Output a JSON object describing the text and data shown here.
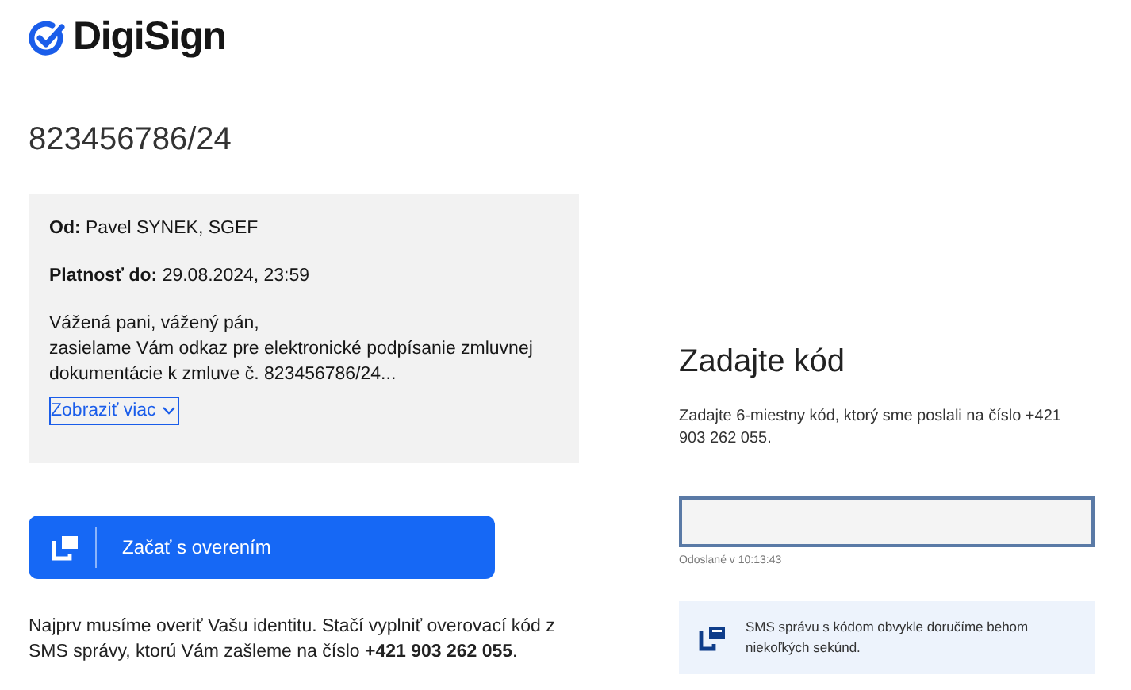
{
  "logo": {
    "text": "DigiSign"
  },
  "document_number": "823456786/24",
  "message_card": {
    "from_label": "Od:",
    "from_value": "Pavel SYNEK, SGEF",
    "valid_label": "Platnosť do:",
    "valid_value": "29.08.2024, 23:59",
    "greeting": "Vážená pani, vážený pán,",
    "body": "zasielame Vám odkaz pre elektronické podpísanie zmluvnej dokumentácie k zmluve č. 823456786/24...",
    "show_more": "Zobraziť viac"
  },
  "start_button": {
    "label": "Začať s overením"
  },
  "note": "Najprv musíme overiť Vašu identitu. Stačí vyplniť overovací kód z SMS správy, ktorú Vám zašleme na číslo **+421 903 262 055**.",
  "code_panel": {
    "title": "Zadajte kód",
    "description": "Zadajte 6-miestny kód, ktorý sme poslali na číslo +421 903 262 055.",
    "helper": "Odoslané v 10:13:43",
    "info": "SMS správu s kódom obvykle doručíme behom niekoľkých sekúnd."
  }
}
